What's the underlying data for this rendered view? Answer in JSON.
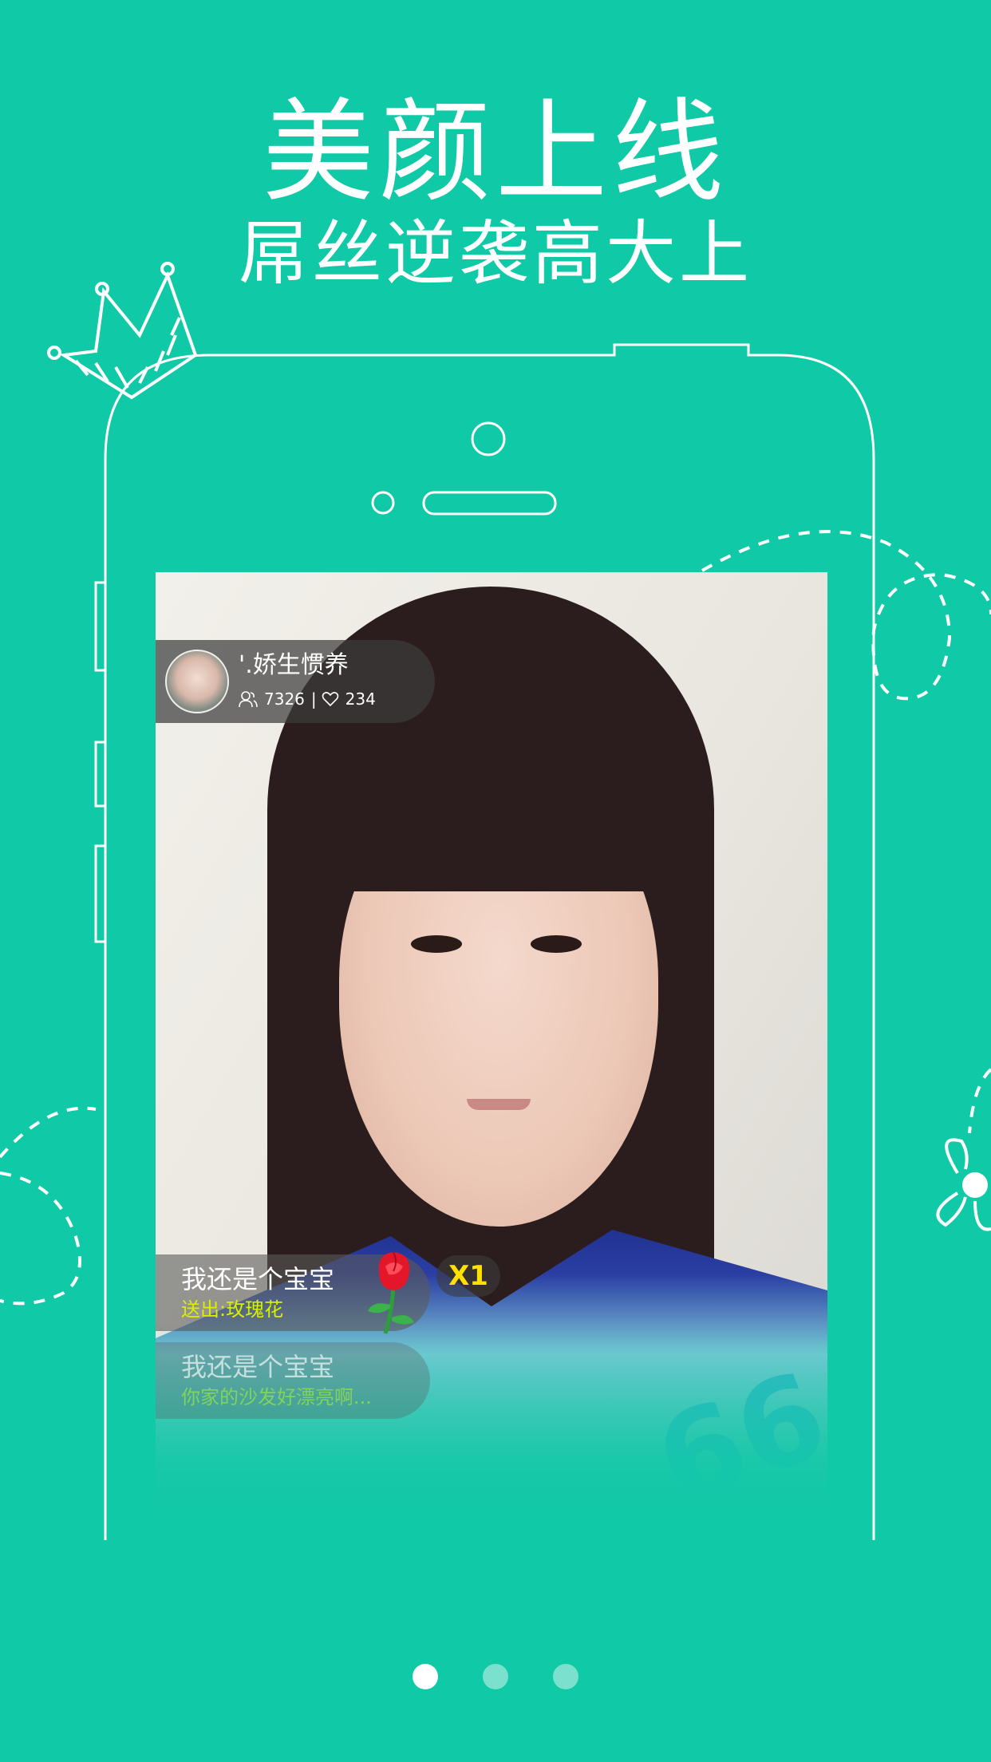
{
  "headline": {
    "main": "美颜上线",
    "sub": "屌丝逆袭高大上"
  },
  "stream": {
    "streamer_name": "'.娇生惯养",
    "viewers": "7326",
    "likes": "234",
    "viewer_icon": "users-icon",
    "like_icon": "heart-icon"
  },
  "messages": [
    {
      "user": "我还是个宝宝",
      "text": "送出:玫瑰花"
    },
    {
      "user": "我还是个宝宝",
      "text": "你家的沙发好漂亮啊..."
    }
  ],
  "gift": {
    "icon": "rose-icon",
    "count": "X1"
  },
  "pagination": {
    "total": 3,
    "active_index": 0
  },
  "colors": {
    "background": "#10c9a6",
    "accent_yellow": "#d8f000",
    "badge_text": "#ffe100"
  }
}
